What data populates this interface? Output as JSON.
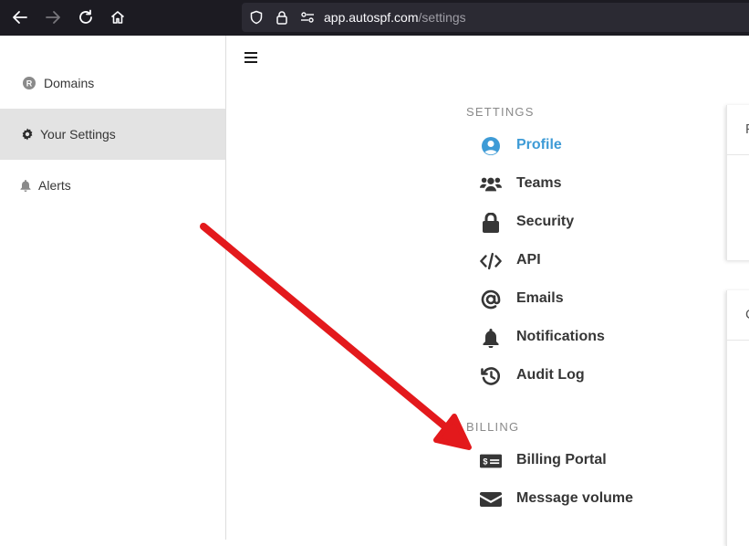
{
  "browser": {
    "url_host": "app.autospf.com",
    "url_path": "/settings"
  },
  "sidebar": {
    "items": [
      {
        "label": "Domains",
        "icon": "registered-icon"
      },
      {
        "label": "Your Settings",
        "icon": "gear-icon"
      },
      {
        "label": "Alerts",
        "icon": "bell-icon"
      }
    ]
  },
  "settings": {
    "section_label": "SETTINGS",
    "items": [
      {
        "label": "Profile",
        "icon": "user-circle-icon"
      },
      {
        "label": "Teams",
        "icon": "users-icon"
      },
      {
        "label": "Security",
        "icon": "lock-icon"
      },
      {
        "label": "API",
        "icon": "code-icon"
      },
      {
        "label": "Emails",
        "icon": "at-icon"
      },
      {
        "label": "Notifications",
        "icon": "bell-icon"
      },
      {
        "label": "Audit Log",
        "icon": "history-icon"
      }
    ]
  },
  "billing": {
    "section_label": "BILLING",
    "items": [
      {
        "label": "Billing Portal",
        "icon": "money-bill-icon"
      },
      {
        "label": "Message volume",
        "icon": "envelope-icon"
      }
    ]
  },
  "cards": [
    {
      "letter": "P"
    },
    {
      "letter": "C"
    }
  ],
  "colors": {
    "accent": "#3e9bd6",
    "annotation_arrow": "#e3191c"
  }
}
